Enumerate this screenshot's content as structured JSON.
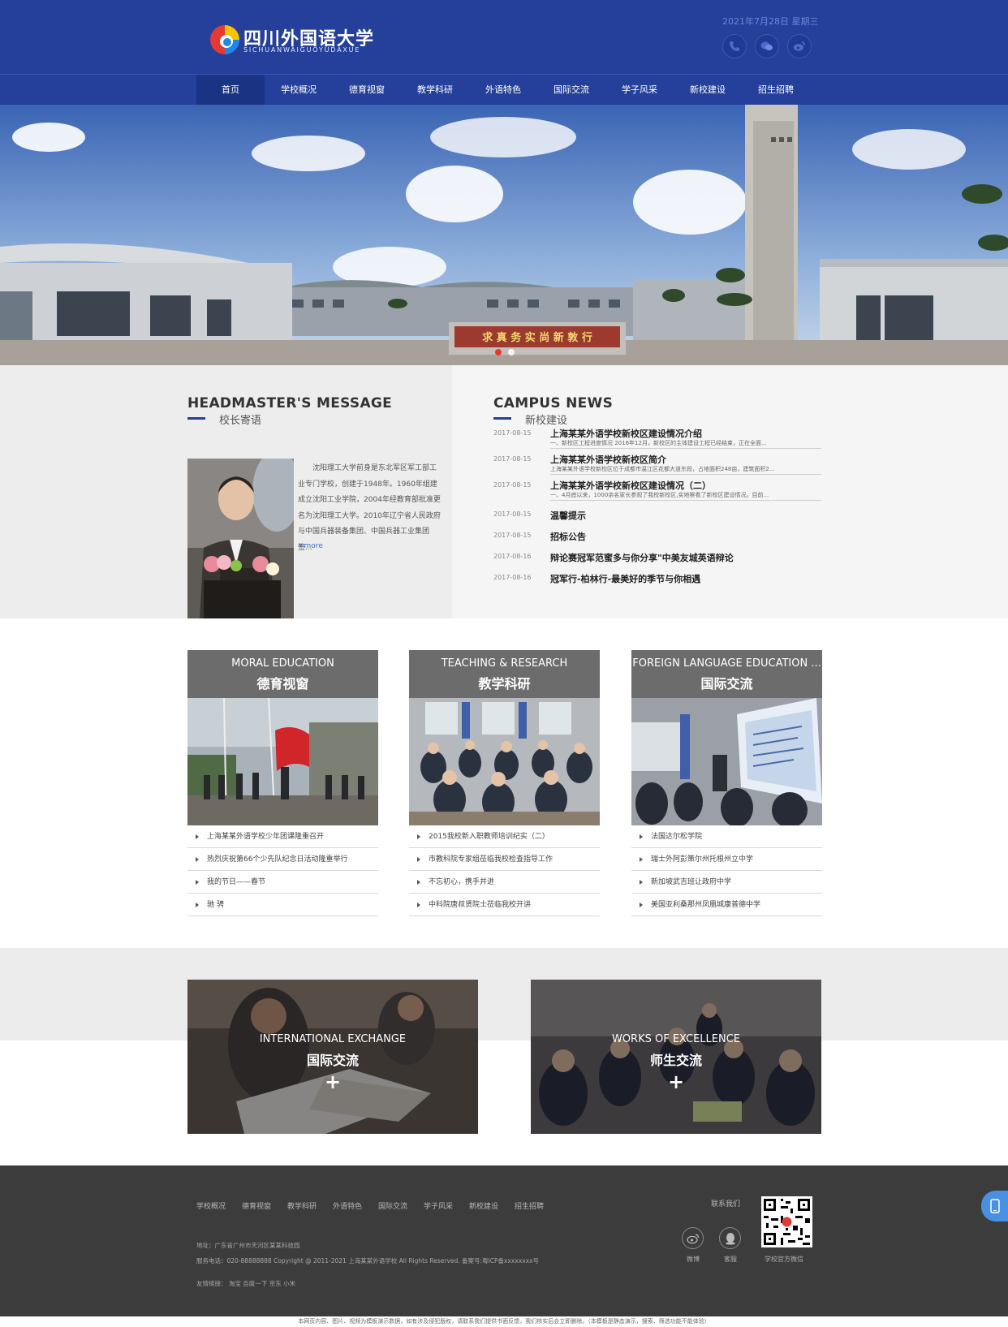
{
  "header": {
    "logo_cn": "四川外国语大学",
    "logo_pinyin": "SICHUANWAIGUOYUDAXUE",
    "date": "2021年7月28日  星期三",
    "icons": [
      "phone-icon",
      "wechat-icon",
      "weibo-icon"
    ]
  },
  "nav": {
    "items": [
      "首页",
      "学校概况",
      "德育视窗",
      "教学科研",
      "外语特色",
      "国际交流",
      "学子风采",
      "新校建设",
      "招生招聘"
    ]
  },
  "banner": {
    "gate_text": "求 真   务 实   尚 新   敦 行"
  },
  "headmaster": {
    "title": "HEADMASTER'S MESSAGE",
    "subtitle": "校长寄语",
    "text": "沈阳理工大学前身是东北军区军工部工业专门学校，创建于1948年。1960年组建成立沈阳工业学院，2004年经教育部批准更名为沈阳理工大学。2010年辽宁省人民政府与中国兵器装备集团、中国兵器工业集团签...",
    "more": "+more"
  },
  "news": {
    "title": "CAMPUS NEWS",
    "subtitle": "新校建设",
    "featured": [
      {
        "date": "2017-08-15",
        "title": "上海某某外语学校新校区建设情况介绍",
        "desc": "一、新校区工程进度情况 2016年12月，新校区的主体建设工程已经结束，正在全面..."
      },
      {
        "date": "2017-08-15",
        "title": "上海某某外语学校新校区简介",
        "desc": "上海某某外语学校新校区位于成都市温江区花都大道东段，占地面积248亩，建筑面积2..."
      },
      {
        "date": "2017-08-15",
        "title": "上海某某外语学校新校区建设情况（二）",
        "desc": "一、4月底以来，1000余名家长参观了我校新校区,实地察看了新校区建设情况。目前..."
      }
    ],
    "items": [
      {
        "date": "2017-08-15",
        "title": "温馨提示"
      },
      {
        "date": "2017-08-15",
        "title": "招标公告"
      },
      {
        "date": "2017-08-16",
        "title": "辩论赛冠军范蜜多与你分享\"中美友城英语辩论"
      },
      {
        "date": "2017-08-16",
        "title": "冠军行-柏林行-最美好的季节与你相遇"
      }
    ]
  },
  "cards": [
    {
      "en": "MORAL EDUCATION",
      "cn": "德育视窗",
      "items": [
        "上海某某外语学校少年团课隆重召开",
        "热烈庆祝第66个少先队纪念日活动隆重举行",
        "我的节日——春节",
        "驰 骋"
      ]
    },
    {
      "en": "TEACHING & RESEARCH",
      "cn": "教学科研",
      "items": [
        "2015我校新入职教师培训纪实（二）",
        "市教科院专家组莅临我校检查指导工作",
        "不忘初心，携手并进",
        "中科院唐叔贤院士莅临我校开讲"
      ]
    },
    {
      "en": "FOREIGN LANGUAGE EDUCATION ...",
      "cn": "国际交流",
      "items": [
        "法国达尔松学院",
        "瑞士外阿彭策尔州托根州立中学",
        "新加坡武吉班让政府中学",
        "美国亚利桑那州凤凰城康普德中学"
      ]
    }
  ],
  "features": [
    {
      "en": "INTERNATIONAL EXCHANGE",
      "cn": "国际交流",
      "plus": "+"
    },
    {
      "en": "WORKS OF EXCELLENCE",
      "cn": "师生交流",
      "plus": "+"
    }
  ],
  "footer": {
    "nav": [
      "学校概况",
      "德育视窗",
      "教学科研",
      "外语特色",
      "国际交流",
      "学子风采",
      "新校建设",
      "招生招聘"
    ],
    "address": "地址：广东省广州市天河区某某科技园",
    "phone": "服务电话：020-88888888 Copyright @ 2011-2021 上海某某外语学校 All Rights Reserved.    备案号:粤ICP备xxxxxxxx号",
    "links": "友情链接：  淘宝      百度一下      京东      小米",
    "contact": "联系我们",
    "weibo": "微博",
    "qq": "客服",
    "qr_label": "学校官方微信",
    "disclaimer": "本网页内容、图片、视频为模板演示数据，如有涉及侵犯版权，请联系我们提供书面反馈，我们核实后会立即删除。（本模板是静态演示，搜索、筛选功能不能体验）"
  },
  "colors": {
    "brand": "#25409a",
    "nav_active": "#1b3383",
    "card_head": "#6c6c6c",
    "footer": "#3c3c3c",
    "side_button": "#4a90e2"
  }
}
